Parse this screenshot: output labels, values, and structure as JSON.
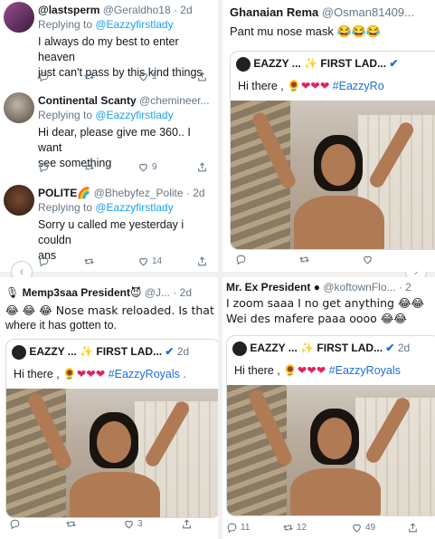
{
  "tweets": [
    {
      "name": "@lastsperm",
      "handle": "@Geraldho18 · 2d",
      "reply_prefix": "Replying to ",
      "reply_handle": "@Eazzyfirstlady",
      "line1": "I always do my best to enter heaven",
      "line2": "just can't pass by this kind things",
      "reply_count": "",
      "retweet_count": "",
      "like_count": "1"
    },
    {
      "name": "Continental Scanty",
      "handle": "@chemineer...",
      "reply_prefix": "Replying to ",
      "reply_handle": "@Eazzyfirstlady",
      "line1": "Hi dear, please give me 360.. I want",
      "line2": "see something",
      "reply_count": "",
      "retweet_count": "",
      "like_count": "9"
    },
    {
      "name": "POLITE",
      "name_emoji": "🌈",
      "handle": "@Bhebyfez_Polite · 2d",
      "reply_prefix": "Replying to ",
      "reply_handle": "@Eazzyfirstlady",
      "line1": "Sorry u called me yesterday i couldn",
      "line2": "ans",
      "reply_count": "",
      "retweet_count": "",
      "like_count": "14"
    },
    {
      "name": "Ghanaian Rema",
      "handle": "@Osman81409...",
      "text": "Pant mu nose mask 😂😂😂",
      "reply_count": "",
      "retweet_count": "",
      "like_count": ""
    },
    {
      "name": "Memp3saa President",
      "name_prefix": "🎙",
      "name_emoji": "😈",
      "handle": "@J... · 2d",
      "line1": "😂 😂 😂 Nose mask reloaded. Is that",
      "line2": "where it has gotten to.",
      "reply_count": "",
      "retweet_count": "",
      "like_count": "3"
    },
    {
      "name": "Mr. Ex President",
      "handle": "@koftownFlo... · 2",
      "line1": "I zoom saaa I no get anything 😂😂",
      "line2": "Wei des mafere paaa oooo 😂😂",
      "reply_count": "11",
      "retweet_count": "12",
      "like_count": "49"
    }
  ],
  "quoted": {
    "name": "EAZZY ... ✨ FIRST LAD...",
    "name_short": "EAZZY ... ✨ FIRST LAD...",
    "date": "2d",
    "text_prefix": "Hi there , ",
    "text_emojis": "🌻❤❤❤",
    "hashtag": "#EazzyRoyals",
    "hashtag_cut": "#EazzyRo",
    "hashtag_dot": "#EazzyRoyals ."
  },
  "nav": {
    "left": "‹",
    "right": "›"
  },
  "colors": {
    "link": "#1da1f2",
    "gray": "#657786",
    "heart": "#e0245e"
  },
  "icons": [
    "reply-icon",
    "retweet-icon",
    "like-icon",
    "share-icon",
    "verified-icon"
  ]
}
